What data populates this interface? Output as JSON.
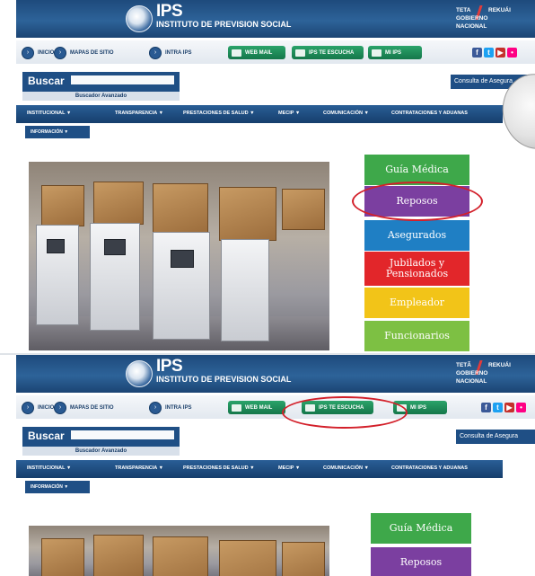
{
  "screenshot_top": {
    "header": {
      "logo_text": "IPS",
      "logo_subtitle": "INSTITUTO DE PREVISION SOCIAL",
      "gov_line1": "TETA",
      "gov_line1b": "REKUÁI",
      "gov_line2": "GOBIERNO NACIONAL"
    },
    "nav": {
      "links": [
        "INICIO",
        "MAPAS DE SITIO",
        "INTRA IPS"
      ]
    },
    "toolbar": {
      "webmail_label": "WEB MAIL",
      "escucha_label": "IPS TE ESCUCHA",
      "mips_label": "MI IPS"
    },
    "search": {
      "label": "Buscar",
      "placeholder": "",
      "advanced_label": "Buscador Avanzado"
    },
    "consulta_label": "Consulta de Asegura",
    "menu": {
      "items": [
        "INSTITUCIONAL ▼",
        "TRANSPARENCIA ▼",
        "PRESTACIONES DE SALUD ▼",
        "MECIP ▼",
        "COMUNICACIÓN ▼",
        "CONTRATACIONES Y ADUANAS"
      ],
      "submenu": "INFORMACIÓN ▼"
    },
    "side_buttons": [
      {
        "label": "Guía Médica",
        "color": "#3ea84a"
      },
      {
        "label": "Reposos",
        "color": "#7b3fa0"
      },
      {
        "label": "Asegurados",
        "color": "#1f7fc4"
      },
      {
        "label": "Jubilados y Pensionados",
        "color": "#e2262a"
      },
      {
        "label": "Empleador",
        "color": "#f2c418"
      },
      {
        "label": "Funcionarios",
        "color": "#7dc043"
      }
    ]
  },
  "screenshot_bottom": {
    "header": {
      "logo_text": "IPS",
      "logo_subtitle": "INSTITUTO DE PREVISION SOCIAL",
      "gov_line1": "TETÃ",
      "gov_line1b": "REKUÁI",
      "gov_line2": "GOBIERNO NACIONAL"
    },
    "nav": {
      "links": [
        "INICIO",
        "MAPAS DE SITIO",
        "INTRA IPS"
      ]
    },
    "toolbar": {
      "webmail_label": "WEB MAIL",
      "escucha_label": "IPS TE ESCUCHA",
      "mips_label": "MI IPS"
    },
    "search": {
      "label": "Buscar",
      "placeholder": "",
      "advanced_label": "Buscador Avanzado"
    },
    "consulta_label": "Consulta de Asegura",
    "menu": {
      "items": [
        "INSTITUCIONAL ▼",
        "TRANSPARENCIA ▼",
        "PRESTACIONES DE SALUD ▼",
        "MECIP ▼",
        "COMUNICACIÓN ▼",
        "CONTRATACIONES Y ADUANAS"
      ],
      "submenu": "INFORMACIÓN ▼"
    },
    "side_buttons": [
      {
        "label": "Guía Médica",
        "color": "#3ea84a"
      },
      {
        "label": "Reposos",
        "color": "#7b3fa0"
      }
    ]
  },
  "colors": {
    "header_blue": "#1e4a7c",
    "highlight_red": "#d3202a",
    "pill_green": "#15774a"
  }
}
